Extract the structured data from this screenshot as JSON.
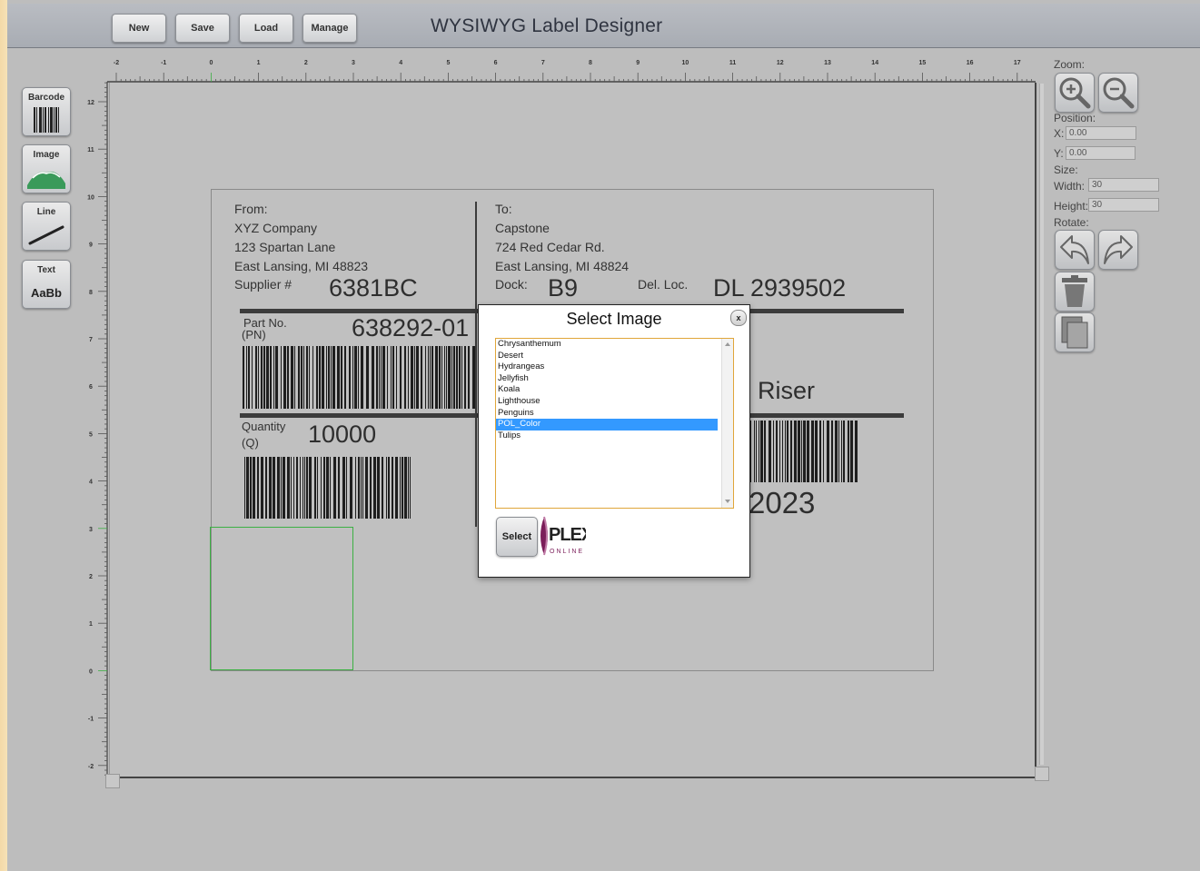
{
  "toolbar": {
    "new_label": "New",
    "save_label": "Save",
    "load_label": "Load",
    "manage_label": "Manage"
  },
  "app_title": "WYSIWYG Label Designer",
  "tools": [
    {
      "label": "Barcode",
      "icon": "barcode-icon"
    },
    {
      "label": "Image",
      "icon": "image-icon"
    },
    {
      "label": "Line",
      "icon": "line-icon"
    },
    {
      "label": "Text",
      "icon": "text-icon",
      "sample": "AaBb"
    }
  ],
  "ruler": {
    "top": [
      "-2",
      "-1",
      "0",
      "1",
      "2",
      "3",
      "4",
      "5",
      "6",
      "7",
      "8",
      "9",
      "10",
      "11",
      "12",
      "13",
      "14",
      "15",
      "16",
      "17"
    ],
    "left": [
      "12",
      "11",
      "10",
      "9",
      "8",
      "7",
      "6",
      "5",
      "4",
      "3",
      "2",
      "1",
      "0",
      "-1",
      "-2"
    ]
  },
  "label": {
    "from_header": "From:",
    "from_lines": [
      "XYZ Company",
      "123 Spartan Lane",
      "East Lansing, MI 48823"
    ],
    "supplier_label": "Supplier #",
    "supplier_value": "6381BC",
    "to_header": "To:",
    "to_lines": [
      "Capstone",
      "724 Red Cedar Rd.",
      "East Lansing, MI 48824"
    ],
    "dock_label": "Dock:",
    "dock_value": "B9",
    "del_loc_label": "Del. Loc.",
    "del_loc_value": "DL 2939502",
    "part_label": "Part No.",
    "part_sub": "(PN)",
    "part_value": "638292-01",
    "desc_partial": "Riser",
    "qty_label": "Quantity",
    "qty_sub": "(Q)",
    "qty_value": "10000",
    "serial_partial": "2023"
  },
  "right_panel": {
    "zoom_label": "Zoom:",
    "position_label": "Position:",
    "x_label": "X:",
    "x_value": "0.00",
    "y_label": "Y:",
    "y_value": "0.00",
    "size_label": "Size:",
    "width_label": "Width:",
    "width_value": "30",
    "height_label": "Height:",
    "height_value": "30",
    "rotate_label": "Rotate:"
  },
  "dialog": {
    "title": "Select Image",
    "close_label": "x",
    "items": [
      "Chrysanthemum",
      "Desert",
      "Hydrangeas",
      "Jellyfish",
      "Koala",
      "Lighthouse",
      "Penguins",
      "POL_Color",
      "Tulips"
    ],
    "selected_index": 7,
    "select_label": "Select",
    "logo_text": "PLEX",
    "logo_sub": "ONLINE"
  },
  "colors": {
    "accent": "#3399ff",
    "selection_box": "#3cb043",
    "list_border": "#e0a63a"
  }
}
